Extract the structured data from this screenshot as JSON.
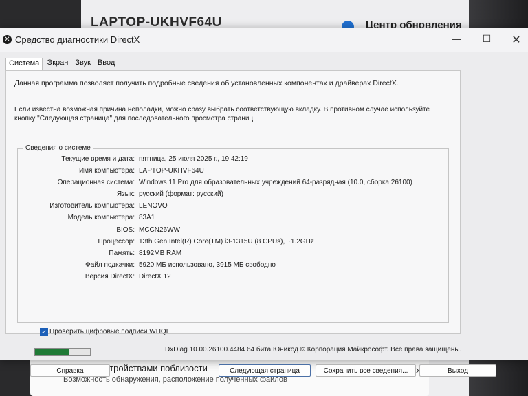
{
  "background": {
    "pc_name": "LAPTOP-UKHVF64U",
    "update_center": "Центр обновления",
    "nearby_share": {
      "title": "Обмен с устройствами поблизости",
      "subtitle": "Возможность обнаружения, расположение полученных файлов"
    }
  },
  "window": {
    "title": "Средство диагностики DirectX"
  },
  "tabs": [
    "Система",
    "Экран",
    "Звук",
    "Ввод"
  ],
  "active_tab": "Система",
  "intro": "Данная программа позволяет получить подробные сведения об установленных компонентах и драйверах DirectX.",
  "hint": "Если известна возможная причина неполадки, можно сразу выбрать соответствующую вкладку. В противном случае используйте кнопку \"Следующая страница\" для последовательного просмотра страниц.",
  "system_info": {
    "legend": "Сведения о системе",
    "rows": [
      {
        "label": "Текущие время и дата:",
        "value": "пятница, 25 июля 2025 г., 19:42:19"
      },
      {
        "label": "Имя компьютера:",
        "value": "LAPTOP-UKHVF64U"
      },
      {
        "label": "Операционная система:",
        "value": "Windows 11 Pro для образовательных учреждений 64-разрядная (10.0, сборка 26100)"
      },
      {
        "label": "Язык:",
        "value": "русский (формат: русский)"
      },
      {
        "label": "Изготовитель компьютера:",
        "value": "LENOVO"
      },
      {
        "label": "Модель компьютера:",
        "value": "83A1"
      },
      {
        "label": "BIOS:",
        "value": "MCCN26WW"
      },
      {
        "label": "Процессор:",
        "value": "13th Gen Intel(R) Core(TM) i3-1315U (8 CPUs), ~1.2GHz"
      },
      {
        "label": "Память:",
        "value": "8192MB RAM"
      },
      {
        "label": "Файл подкачки:",
        "value": "5920 МБ использовано, 3915 МБ свободно"
      },
      {
        "label": "Версия DirectX:",
        "value": "DirectX 12"
      }
    ]
  },
  "whql_checkbox": {
    "label": "Проверить цифровые подписи WHQL",
    "checked": true
  },
  "progress": {
    "fraction": 0.62,
    "color": "#1f7a36"
  },
  "footer": "DxDiag 10.00.26100.4484 64 бита Юникод © Корпорация Майкрософт. Все права защищены.",
  "buttons": {
    "help": "Справка",
    "next": "Следующая страница",
    "save": "Сохранить все сведения...",
    "exit": "Выход"
  }
}
